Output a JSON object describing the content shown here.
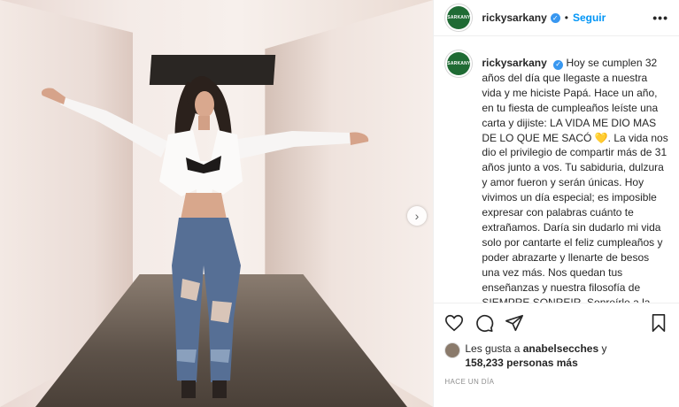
{
  "post": {
    "username": "rickysarkany",
    "avatar_text": "SARKANY",
    "follow_label": "Seguir",
    "separator": "•",
    "more_label": "•••",
    "verified_icon": "check-icon",
    "caption": "Hoy se cumplen 32 años del día que llegaste a nuestra vida y me hiciste Papá. Hace un año, en tu fiesta de cumpleaños leíste una carta y dijiste: LA VIDA ME DIO MAS DE LO QUE ME SACÓ 💛. La vida nos dio el privilegio de compartir más de 31 años junto a vos. Tu sabiduria, dulzura y amor fueron y serán únicas. Hoy vivimos un día especial; es imposible expresar con palabras cuánto te extrañamos. Daría sin dudarlo mi vida solo por cantarte el feliz cumpleaños y poder abrazarte y llenarte de besos una vez más. Nos quedan tus enseñanzas y nuestra filosofía de SIEMPRE SONREIR. Sonreírle a la vida aunque a veces, como hoy tengamos un nudo en la garganta que no nos deja respirar.",
    "likes_prefix": "Les gusta a",
    "likes_user": "anabelsecches",
    "likes_middle": "y",
    "likes_count": "158,233 personas más",
    "timestamp": "HACE UN DÍA",
    "next_arrow": "›"
  },
  "colors": {
    "accent": "#0095f6",
    "verified": "#3897f0",
    "avatar_bg": "#1f6b34"
  },
  "icons": [
    "heart-icon",
    "comment-icon",
    "share-icon",
    "bookmark-icon",
    "chevron-right-icon"
  ]
}
